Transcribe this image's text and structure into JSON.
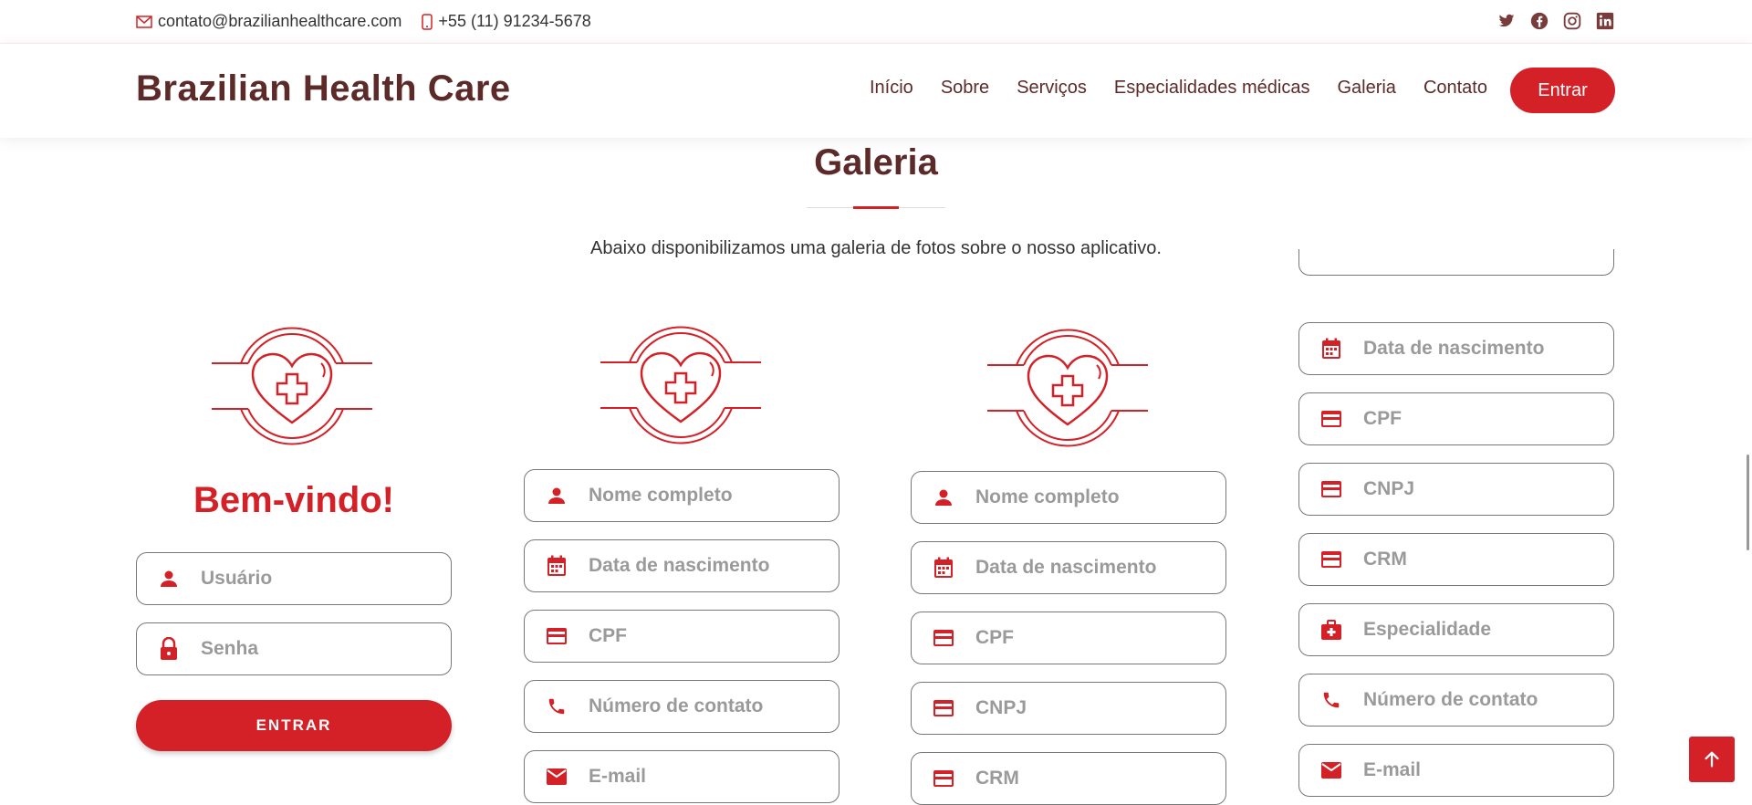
{
  "topbar": {
    "email": "contato@brazilianhealthcare.com",
    "phone": "+55 (11) 91234-5678",
    "social_icons": [
      "twitter-icon",
      "facebook-icon",
      "instagram-icon",
      "linkedin-icon"
    ]
  },
  "header": {
    "logo": "Brazilian Health Care",
    "nav": [
      "Início",
      "Sobre",
      "Serviços",
      "Especialidades médicas",
      "Galeria",
      "Contato"
    ],
    "cta": "Entrar"
  },
  "section": {
    "title": "Galeria",
    "subtitle": "Abaixo disponibilizamos uma galeria de fotos sobre o nosso aplicativo."
  },
  "gallery": {
    "login": {
      "welcome": "Bem-vindo!",
      "fields": [
        {
          "placeholder": "Usuário",
          "icon": "user-icon"
        },
        {
          "placeholder": "Senha",
          "icon": "lock-icon"
        }
      ],
      "button": "ENTRAR"
    },
    "register_patient": {
      "fields": [
        {
          "placeholder": "Nome completo",
          "icon": "user-icon"
        },
        {
          "placeholder": "Data de nascimento",
          "icon": "calendar-icon"
        },
        {
          "placeholder": "CPF",
          "icon": "card-icon"
        },
        {
          "placeholder": "Número de contato",
          "icon": "phone-icon"
        },
        {
          "placeholder": "E-mail",
          "icon": "mail-icon"
        }
      ]
    },
    "register_clinic": {
      "fields": [
        {
          "placeholder": "Nome completo",
          "icon": "user-icon"
        },
        {
          "placeholder": "Data de nascimento",
          "icon": "calendar-icon"
        },
        {
          "placeholder": "CPF",
          "icon": "card-icon"
        },
        {
          "placeholder": "CNPJ",
          "icon": "card-icon"
        },
        {
          "placeholder": "CRM",
          "icon": "card-icon"
        }
      ]
    },
    "register_doctor": {
      "fields": [
        {
          "placeholder": "Data de nascimento",
          "icon": "calendar-icon"
        },
        {
          "placeholder": "CPF",
          "icon": "card-icon"
        },
        {
          "placeholder": "CNPJ",
          "icon": "card-icon"
        },
        {
          "placeholder": "CRM",
          "icon": "card-icon"
        },
        {
          "placeholder": "Especialidade",
          "icon": "medical-bag-icon"
        },
        {
          "placeholder": "Número de contato",
          "icon": "phone-icon"
        },
        {
          "placeholder": "E-mail",
          "icon": "mail-icon"
        }
      ]
    }
  },
  "colors": {
    "accent": "#d32127",
    "brand_dark": "#5d2a2a"
  }
}
